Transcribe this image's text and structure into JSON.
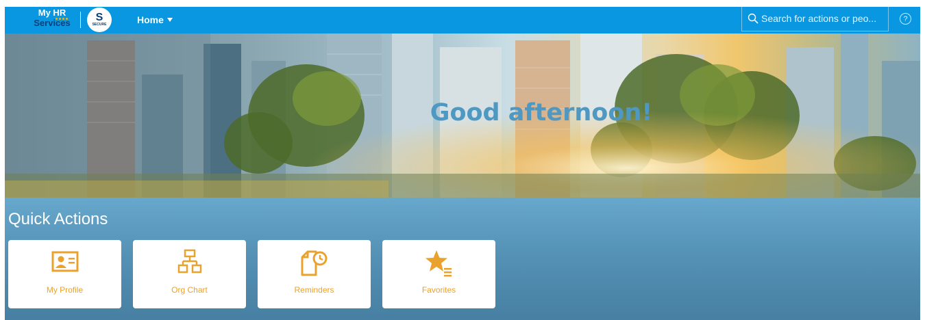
{
  "header": {
    "logo_line1": "My HR",
    "logo_line2": "Services",
    "badge_letter": "S",
    "badge_subtext": "SECURE",
    "home_label": "Home",
    "search_placeholder": "Search for actions or peo...",
    "help_glyph": "?"
  },
  "hero": {
    "greeting": "Good afternoon!"
  },
  "quick_actions": {
    "title": "Quick Actions",
    "tiles": [
      {
        "label": "My Profile",
        "icon": "profile-card-icon"
      },
      {
        "label": "Org Chart",
        "icon": "org-chart-icon"
      },
      {
        "label": "Reminders",
        "icon": "reminder-clock-icon"
      },
      {
        "label": "Favorites",
        "icon": "favorites-star-icon"
      }
    ]
  },
  "colors": {
    "topbar": "#0897e0",
    "accent_orange": "#e9a22d",
    "greeting": "#4e98c2",
    "content_bg": "#5592b6"
  }
}
